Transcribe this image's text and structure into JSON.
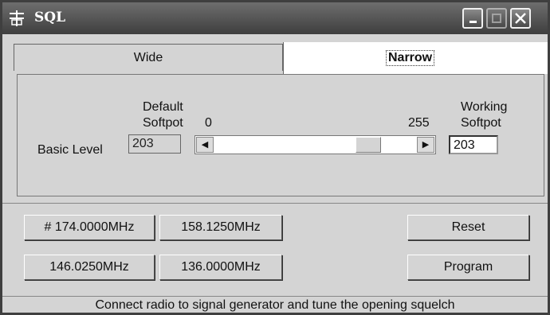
{
  "window": {
    "title": "SQL",
    "icon": "antenna-icon",
    "controls": [
      "minimize-icon",
      "maximize-icon",
      "close-icon"
    ]
  },
  "tabs": [
    {
      "label": "Wide",
      "active": false
    },
    {
      "label": "Narrow",
      "active": true
    }
  ],
  "panel": {
    "row_label": "Basic Level",
    "default_softpot": {
      "label_line1": "Default",
      "label_line2": "Softpot",
      "value": "203"
    },
    "slider": {
      "min_label": "0",
      "max_label": "255",
      "value": 203,
      "min": 0,
      "max": 255
    },
    "working_softpot": {
      "label_line1": "Working",
      "label_line2": "Softpot",
      "value": "203"
    }
  },
  "frequency_buttons": [
    "# 174.0000MHz",
    "158.1250MHz",
    "146.0250MHz",
    "136.0000MHz"
  ],
  "actions": {
    "reset_label": "Reset",
    "program_label": "Program"
  },
  "status_bar": {
    "text": "Connect radio to signal generator and tune the opening squelch"
  }
}
